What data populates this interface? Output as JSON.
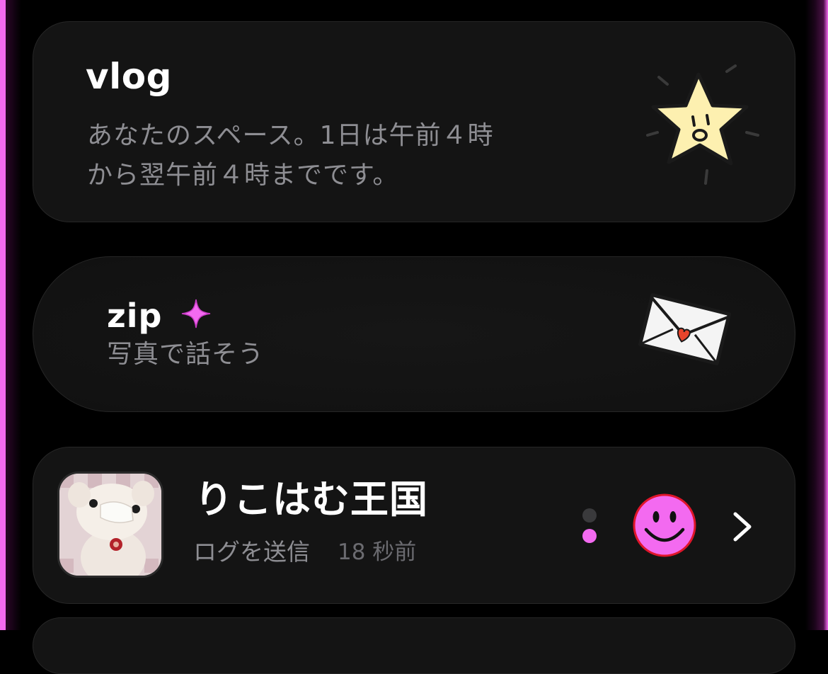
{
  "vlog_card": {
    "title": "vlog",
    "description_line1": "あなたのスペース。1日は午前４時",
    "description_line2": "から翌午前４時までです。",
    "icon": "star-icon"
  },
  "zip_card": {
    "title": "zip",
    "subtitle": "写真で話そう",
    "icons": [
      "sparkle-icon",
      "envelope-icon"
    ]
  },
  "group_card": {
    "name": "りこはむ王国",
    "status": "ログを送信",
    "time": "18 秒前",
    "icons": [
      "avatar",
      "smiley-icon",
      "chevron-right-icon"
    ]
  },
  "colors": {
    "accent_pink": "#f36af0",
    "card_bg": "#141414",
    "secondary_text": "#8e8e93",
    "star_fill": "#fdf0b0"
  }
}
